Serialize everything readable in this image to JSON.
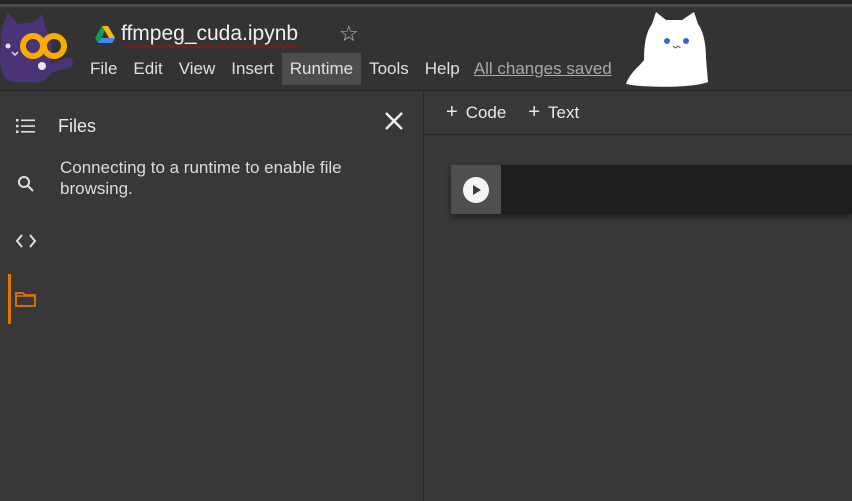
{
  "header": {
    "notebook_title": "ffmpeg_cuda.ipynb",
    "star_icon": "star-outline-icon",
    "save_status": "All changes saved",
    "menu": [
      {
        "label": "File"
      },
      {
        "label": "Edit"
      },
      {
        "label": "View"
      },
      {
        "label": "Insert"
      },
      {
        "label": "Runtime",
        "active": true
      },
      {
        "label": "Tools"
      },
      {
        "label": "Help"
      }
    ]
  },
  "sidebar": {
    "rail": [
      {
        "icon": "table-of-contents-icon"
      },
      {
        "icon": "search-icon"
      },
      {
        "icon": "code-snippets-icon"
      },
      {
        "icon": "folder-icon",
        "active": true
      }
    ],
    "accent": "#e37400",
    "panel": {
      "title": "Files",
      "message": "Connecting to a runtime to enable file browsing."
    }
  },
  "toolbar": {
    "add_code_label": "Code",
    "add_text_label": "Text"
  },
  "notebook": {
    "cells": [
      {
        "type": "code",
        "content": ""
      }
    ]
  }
}
